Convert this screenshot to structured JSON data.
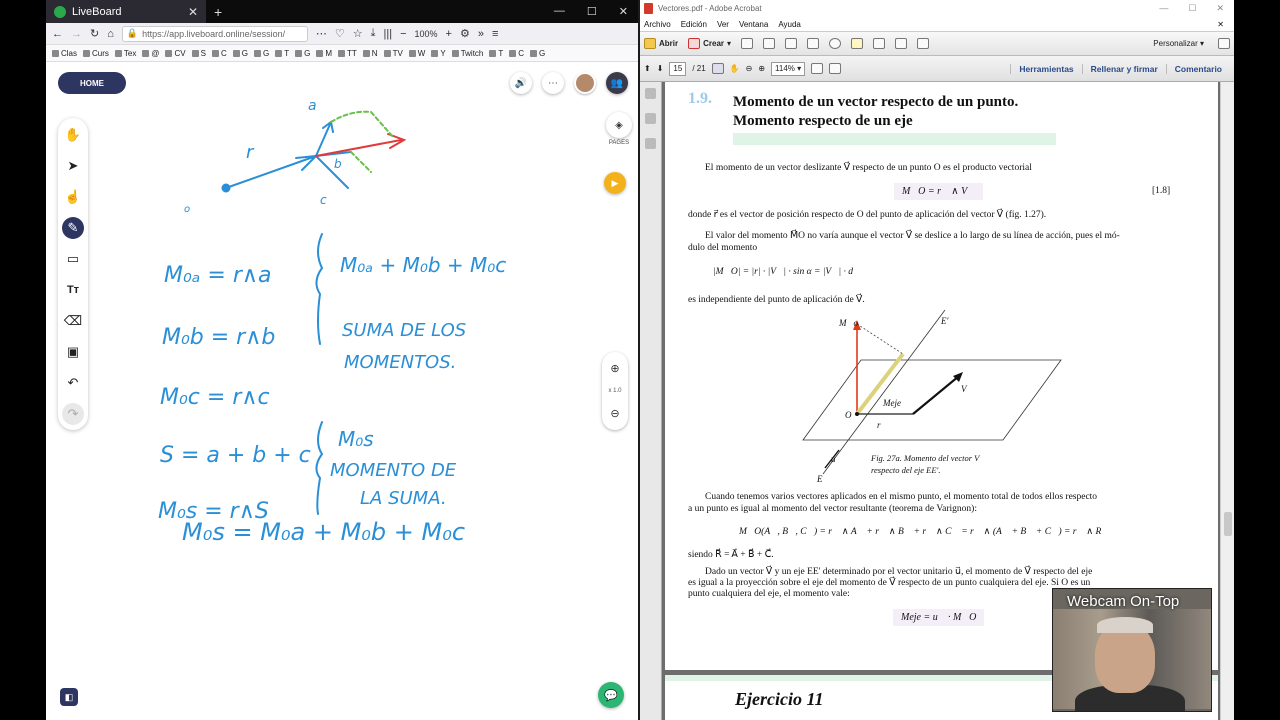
{
  "firefox": {
    "tab_title": "LiveBoard",
    "url": "https://app.liveboard.online/session/",
    "zoom": "100%",
    "bookmarks": [
      "Clas",
      "Curs",
      "Tex",
      "@",
      "CV",
      "S",
      "C",
      "G",
      "G",
      "T",
      "G",
      "M",
      "TT",
      "N",
      "TV",
      "W",
      "Y",
      "Twitch",
      "T",
      "C",
      "G"
    ]
  },
  "liveboard": {
    "home_label": "HOME",
    "pages_label": "PAGES",
    "zoom_level": "x 1.0"
  },
  "acrobat": {
    "title": "Vectores.pdf - Adobe Acrobat",
    "menu": [
      "Archivo",
      "Edición",
      "Ver",
      "Ventana",
      "Ayuda"
    ],
    "open_label": "Abrir",
    "create_label": "Crear",
    "customize_label": "Personalizar",
    "page_current": "15",
    "page_total": "/ 21",
    "zoom": "114%",
    "links": [
      "Herramientas",
      "Rellenar y firmar",
      "Comentario"
    ]
  },
  "pdf": {
    "section_num": "1.9.",
    "heading_1": "Momento de un vector respecto de un punto.",
    "heading_2": "Momento respecto de un eje",
    "p1": "El momento de un vector deslizante V⃗ respecto de un punto O es el producto vectorial",
    "f1": "M⃗O = r⃗ ∧ V⃗",
    "f1_num": "[1.8]",
    "p2": "donde r⃗ es el vector de posición respecto de O del punto de aplicación del vector V⃗ (fig. 1.27).",
    "p3a": "El valor del momento M⃗O no varía aunque el vector V⃗ se deslice a lo largo de su línea de acción, pues el mó-",
    "p3b": "dulo del momento",
    "f2": "|M⃗O| = |r| · |V⃗| · sin α = |V⃗| · d",
    "p4": "es independiente del punto de aplicación de V⃗.",
    "fig_caption_1": "Fig. 27a.  Momento del vector V⃗",
    "fig_caption_2": "respecto del eje EE'.",
    "fig_labels": {
      "mo": "M⃗o",
      "ee": "E'",
      "v": "V⃗",
      "meje": "Meje",
      "o": "O",
      "r": "r⃗",
      "u": "u⃗",
      "e": "E"
    },
    "p5a": "Cuando tenemos varios vectores aplicados en el mismo punto, el momento total de todos ellos respecto",
    "p5b": "a un punto es igual al momento del vector resultante (teorema de Varignon):",
    "f3": "M⃗O(A⃗, B⃗, C⃗) = r⃗ ∧ A⃗ + r⃗ ∧ B⃗ + r⃗ ∧ C⃗ = r⃗ ∧ (A⃗ + B⃗ + C⃗) = r⃗ ∧ R⃗",
    "p6": "siendo R⃗ = A⃗ + B⃗ + C⃗.",
    "p7a": "Dado un vector V⃗ y un eje EE' determinado por el vector unitario u⃗, el momento de V⃗ respecto del eje",
    "p7b": "es igual a la proyección sobre el eje del momento de V⃗ respecto de un punto cualquiera del eje. Si O es un",
    "p7c": "punto cualquiera del eje, el momento vale:",
    "f4": "Meje = u⃗ · M⃗O",
    "next_heading": "Ejercicio 11"
  },
  "webcam_label": "Webcam On-Top",
  "handwriting": {
    "l1": "M₀ₐ = r∧a",
    "l2": "M₀b = r∧b",
    "l3": "M₀c = r∧c",
    "top_sum": "M₀ₐ + M₀b + M₀c",
    "note1": "SUMA DE LOS",
    "note2": "MOMENTOS.",
    "l4": "S = a + b + c",
    "l5": "M₀s = r∧S",
    "m0s": "M₀s",
    "note3": "MOMENTO DE",
    "note4": "LA SUMA.",
    "l6": "M₀s = M₀a + M₀b + M₀c"
  },
  "colors": {
    "ink_blue": "#2a8fd6",
    "ink_red": "#e03a3a",
    "ink_green": "#6ac04a",
    "home_bg": "#2d3561"
  }
}
